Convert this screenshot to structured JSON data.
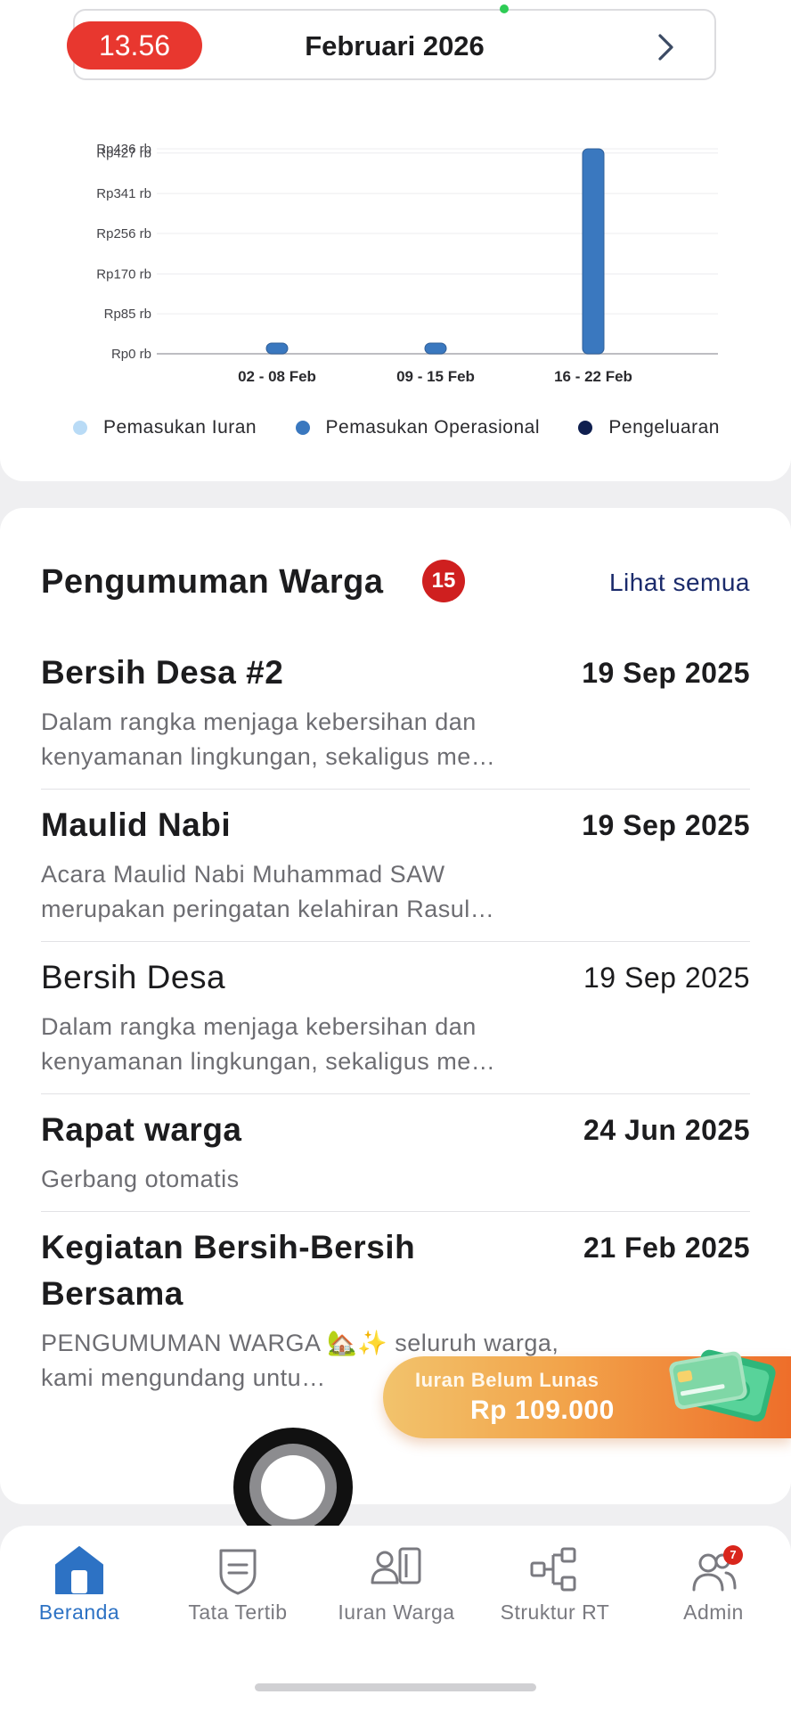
{
  "status_bar": {
    "time": "13.56"
  },
  "month_selector": {
    "label": "Februari 2026",
    "next_icon": "chevron-right-icon"
  },
  "colors": {
    "pemasukan_iuran": "#b9dbf6",
    "pemasukan_operasional": "#3a78bf",
    "pengeluaran": "#0f1f4f",
    "accent": "#2d72c4",
    "badge_red": "#cf1f1f"
  },
  "chart_data": {
    "type": "bar",
    "categories": [
      "02 - 08 Feb",
      "09 - 15 Feb",
      "16 - 22 Feb"
    ],
    "y_tick_labels": [
      "Rp0 rb",
      "Rp85 rb",
      "Rp170 rb",
      "Rp256 rb",
      "Rp341 rb",
      "Rp427 rb",
      "Rp436 rb"
    ],
    "y_ticks": [
      0,
      85,
      170,
      256,
      341,
      427,
      436
    ],
    "ylim": [
      0,
      436
    ],
    "grid": true,
    "legend_position": "bottom",
    "series": [
      {
        "name": "Pemasukan Iuran",
        "values": [
          0,
          0,
          0
        ]
      },
      {
        "name": "Pemasukan Operasional",
        "values": [
          3,
          3,
          436
        ]
      },
      {
        "name": "Pengeluaran",
        "values": [
          0,
          0,
          0
        ]
      }
    ]
  },
  "announcements": {
    "title": "Pengumuman Warga",
    "count": "15",
    "see_all": "Lihat semua",
    "items": [
      {
        "title": "Bersih Desa #2",
        "date": "19 Sep 2025",
        "desc": "Dalam rangka menjaga kebersihan dan kenyamanan lingkungan, sekaligus me…",
        "bold": true
      },
      {
        "title": "Maulid Nabi",
        "date": "19 Sep 2025",
        "desc": "Acara Maulid Nabi Muhammad SAW merupakan peringatan kelahiran Rasul…",
        "bold": true
      },
      {
        "title": "Bersih Desa",
        "date": "19 Sep 2025",
        "desc": "Dalam rangka menjaga kebersihan dan kenyamanan lingkungan, sekaligus me…",
        "bold": false
      },
      {
        "title": "Rapat warga",
        "date": "24 Jun 2025",
        "desc": "Gerbang otomatis",
        "bold": true
      },
      {
        "title": "Kegiatan Bersih-Bersih Bersama",
        "date": "21 Feb 2025",
        "desc": "PENGUMUMAN WARGA 🏡✨ seluruh warga, kami mengundang untu…",
        "bold": true
      }
    ]
  },
  "due_banner": {
    "label": "Iuran Belum Lunas",
    "amount": "Rp 109.000",
    "icon": "money-card-icon"
  },
  "tabbar": {
    "tabs": [
      {
        "label": "Beranda",
        "icon": "home-icon"
      },
      {
        "label": "Tata Tertib",
        "icon": "shield-icon"
      },
      {
        "label": "Iuran Warga",
        "icon": "user-card-icon"
      },
      {
        "label": "Struktur RT",
        "icon": "org-chart-icon"
      },
      {
        "label": "Admin",
        "icon": "users-icon"
      }
    ],
    "admin_badge": "7"
  }
}
